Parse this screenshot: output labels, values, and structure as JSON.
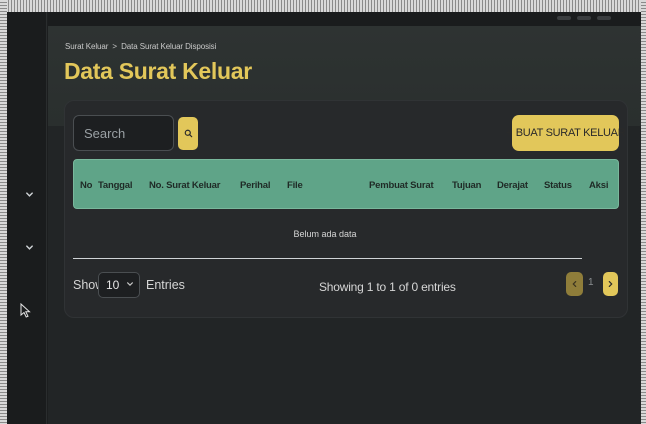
{
  "breadcrumb": {
    "parent": "Surat Keluar",
    "separator": ">",
    "current": "Data Surat Keluar Disposisi"
  },
  "page": {
    "title": "Data Surat Keluar"
  },
  "toolbar": {
    "search_placeholder": "Search",
    "create_label": "BUAT SURAT KELUAR",
    "create_icon": "+"
  },
  "table": {
    "columns": [
      "No",
      "Tanggal",
      "No. Surat Keluar",
      "Perihal",
      "File",
      "Pembuat Surat",
      "Tujuan",
      "Derajat",
      "Status",
      "Aksi"
    ],
    "empty_message": "Belum ada data"
  },
  "footer": {
    "show_label": "Show",
    "entries_value": "10",
    "entries_label": "Entries",
    "info": "Showing 1 to 1 of 0 entries",
    "current_page": "1"
  },
  "colors": {
    "accent": "#e2c75a",
    "table_header": "#5fa488",
    "background": "#222526"
  },
  "icons": {
    "search": "search-icon",
    "next": "chevron-right-icon",
    "prev": "chevron-left-icon",
    "sidebar": "chevron-down-icon"
  }
}
